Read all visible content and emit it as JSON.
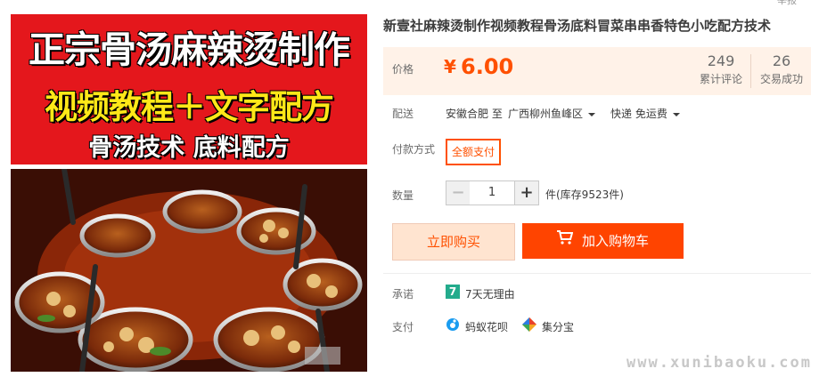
{
  "banner": {
    "line1": "正宗骨汤麻辣烫制作",
    "line2": "视频教程＋文字配方",
    "line3": "骨汤技术 底料配方"
  },
  "product": {
    "title": "新壹社麻辣烫制作视频教程骨汤底料冒菜串串香特色小吃配方技术",
    "top_partial": "举报"
  },
  "price": {
    "label": "价格",
    "currency": "¥",
    "value": "6.00",
    "reviews_count": "249",
    "reviews_label": "累计评论",
    "sales_count": "26",
    "sales_label": "交易成功",
    "box_color": "#fff2e8",
    "accent_color": "#ff5000"
  },
  "shipping": {
    "label": "配送",
    "from": "安徽合肥 至",
    "to": "广西柳州鱼峰区",
    "method": "快递 免运费"
  },
  "payment_method": {
    "label": "付款方式",
    "option": "全额支付"
  },
  "quantity": {
    "label": "数量",
    "minus": "−",
    "value": "1",
    "plus": "+",
    "stock_text": "件(库存9523件)"
  },
  "actions": {
    "buy_now": "立即购买",
    "add_to_cart": "加入购物车"
  },
  "promise": {
    "label": "承诺",
    "icon_text": "7",
    "text": "7天无理由"
  },
  "pay": {
    "label": "支付",
    "option1": "蚂蚁花呗",
    "option2": "集分宝"
  },
  "watermark": "www.xunibaoku.com"
}
